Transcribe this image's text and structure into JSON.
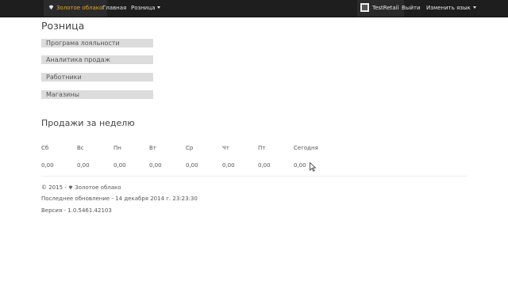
{
  "navbar": {
    "brand": "Золотое облако",
    "home": "Главная",
    "retail": "Розница",
    "user": "TestRetail",
    "logout": "Выйти",
    "language": "Изменить язык"
  },
  "page": {
    "title": "Розница"
  },
  "menu": [
    "Програма лояльности",
    "Аналитика продаж",
    "Работники",
    "Магазины"
  ],
  "weekly": {
    "title": "Продажи за неделю",
    "days": [
      "Сб",
      "Вс",
      "Пн",
      "Вт",
      "Ср",
      "Чт",
      "Пт",
      "Сегодня"
    ],
    "values": [
      "0,00",
      "0,00",
      "0,00",
      "0,00",
      "0,00",
      "0,00",
      "0,00",
      "0,00"
    ]
  },
  "footer": {
    "copyright_prefix": "© 2015 -",
    "copyright_brand": "Золотое облако",
    "last_update": "Последнее обновление - 14 декабря 2014 г. 23:23:30",
    "version": "Версия - 1.0.5461.42103"
  },
  "colors": {
    "navbar": "#1e1e1e",
    "brand": "#e0a92b",
    "menu_bg": "#dcdcdc"
  }
}
